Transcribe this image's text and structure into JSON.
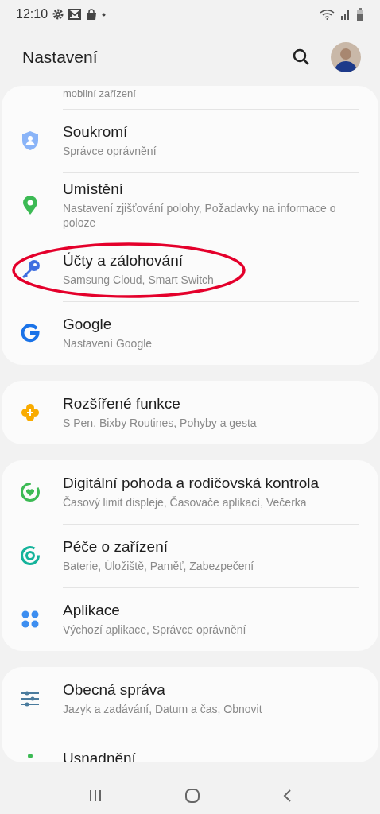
{
  "status_bar": {
    "time": "12:10"
  },
  "header": {
    "title": "Nastavení"
  },
  "groups": [
    {
      "clipped_above": "mobilní zařízení",
      "items": [
        {
          "title": "Soukromí",
          "subtitle": "Správce oprávnění",
          "highlighted": false
        },
        {
          "title": "Umístění",
          "subtitle": "Nastavení zjišťování polohy, Požadavky na informace o poloze",
          "highlighted": false
        },
        {
          "title": "Účty a zálohování",
          "subtitle": "Samsung Cloud, Smart Switch",
          "highlighted": true
        },
        {
          "title": "Google",
          "subtitle": "Nastavení Google",
          "highlighted": false
        }
      ]
    },
    {
      "items": [
        {
          "title": "Rozšířené funkce",
          "subtitle": "S Pen, Bixby Routines, Pohyby a gesta",
          "highlighted": false
        }
      ]
    },
    {
      "items": [
        {
          "title": "Digitální pohoda a rodičovská kontrola",
          "subtitle": "Časový limit displeje, Časovače aplikací, Večerka",
          "highlighted": false
        },
        {
          "title": "Péče o zařízení",
          "subtitle": "Baterie, Úložiště, Paměť, Zabezpečení",
          "highlighted": false
        },
        {
          "title": "Aplikace",
          "subtitle": "Výchozí aplikace, Správce oprávnění",
          "highlighted": false
        }
      ]
    },
    {
      "items": [
        {
          "title": "Obecná správa",
          "subtitle": "Jazyk a zadávání, Datum a čas, Obnovit",
          "highlighted": false
        }
      ],
      "clipped_below": "Usnadnění"
    }
  ]
}
